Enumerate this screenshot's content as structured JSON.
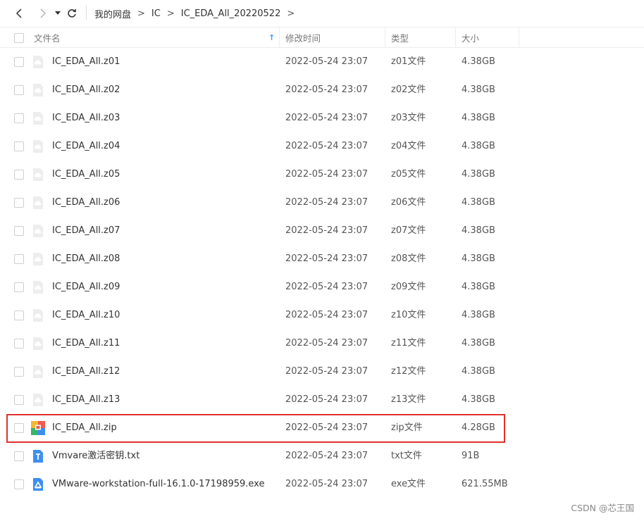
{
  "breadcrumb": [
    {
      "label": "我的网盘"
    },
    {
      "label": "IC"
    },
    {
      "label": "IC_EDA_All_20220522"
    }
  ],
  "header": {
    "name": "文件名",
    "time": "修改时间",
    "type": "类型",
    "size": "大小",
    "sort_indicator": "↑"
  },
  "files": [
    {
      "name": "IC_EDA_All.z01",
      "time": "2022-05-24 23:07",
      "type": "z01文件",
      "size": "4.38GB",
      "icon": "cloud-file-icon"
    },
    {
      "name": "IC_EDA_All.z02",
      "time": "2022-05-24 23:07",
      "type": "z02文件",
      "size": "4.38GB",
      "icon": "cloud-file-icon"
    },
    {
      "name": "IC_EDA_All.z03",
      "time": "2022-05-24 23:07",
      "type": "z03文件",
      "size": "4.38GB",
      "icon": "cloud-file-icon"
    },
    {
      "name": "IC_EDA_All.z04",
      "time": "2022-05-24 23:07",
      "type": "z04文件",
      "size": "4.38GB",
      "icon": "cloud-file-icon"
    },
    {
      "name": "IC_EDA_All.z05",
      "time": "2022-05-24 23:07",
      "type": "z05文件",
      "size": "4.38GB",
      "icon": "cloud-file-icon"
    },
    {
      "name": "IC_EDA_All.z06",
      "time": "2022-05-24 23:07",
      "type": "z06文件",
      "size": "4.38GB",
      "icon": "cloud-file-icon"
    },
    {
      "name": "IC_EDA_All.z07",
      "time": "2022-05-24 23:07",
      "type": "z07文件",
      "size": "4.38GB",
      "icon": "cloud-file-icon"
    },
    {
      "name": "IC_EDA_All.z08",
      "time": "2022-05-24 23:07",
      "type": "z08文件",
      "size": "4.38GB",
      "icon": "cloud-file-icon"
    },
    {
      "name": "IC_EDA_All.z09",
      "time": "2022-05-24 23:07",
      "type": "z09文件",
      "size": "4.38GB",
      "icon": "cloud-file-icon"
    },
    {
      "name": "IC_EDA_All.z10",
      "time": "2022-05-24 23:07",
      "type": "z10文件",
      "size": "4.38GB",
      "icon": "cloud-file-icon"
    },
    {
      "name": "IC_EDA_All.z11",
      "time": "2022-05-24 23:07",
      "type": "z11文件",
      "size": "4.38GB",
      "icon": "cloud-file-icon"
    },
    {
      "name": "IC_EDA_All.z12",
      "time": "2022-05-24 23:07",
      "type": "z12文件",
      "size": "4.38GB",
      "icon": "cloud-file-icon"
    },
    {
      "name": "IC_EDA_All.z13",
      "time": "2022-05-24 23:07",
      "type": "z13文件",
      "size": "4.38GB",
      "icon": "cloud-file-icon"
    },
    {
      "name": "IC_EDA_All.zip",
      "time": "2022-05-24 23:07",
      "type": "zip文件",
      "size": "4.28GB",
      "icon": "zip-archive-icon"
    },
    {
      "name": "Vmvare激活密钥.txt",
      "time": "2022-05-24 23:07",
      "type": "txt文件",
      "size": "91B",
      "icon": "text-file-icon"
    },
    {
      "name": "VMware-workstation-full-16.1.0-17198959.exe",
      "time": "2022-05-24 23:07",
      "type": "exe文件",
      "size": "621.55MB",
      "icon": "exe-file-icon"
    }
  ],
  "watermark": "CSDN @芯王国",
  "colors": {
    "highlight": "#e0312f",
    "accent": "#2f9bff"
  }
}
